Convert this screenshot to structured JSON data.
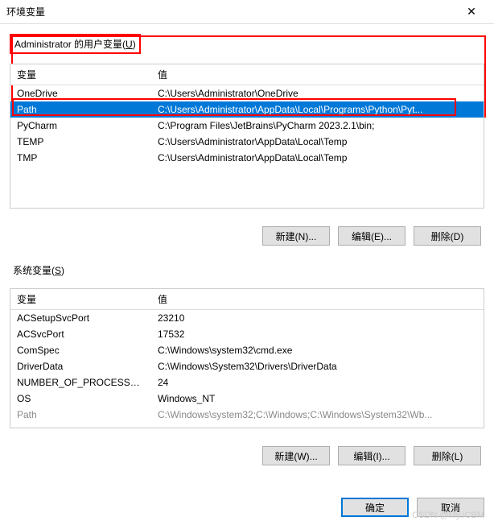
{
  "window": {
    "title": "环境变量"
  },
  "userVars": {
    "label_prefix": "Administrator 的用户变量(",
    "label_key": "U",
    "label_suffix": ")",
    "columns": {
      "name": "变量",
      "value": "值"
    },
    "rows": [
      {
        "name": "OneDrive",
        "value": "C:\\Users\\Administrator\\OneDrive"
      },
      {
        "name": "Path",
        "value": "C:\\Users\\Administrator\\AppData\\Local\\Programs\\Python\\Pyt..."
      },
      {
        "name": "PyCharm",
        "value": "C:\\Program Files\\JetBrains\\PyCharm 2023.2.1\\bin;"
      },
      {
        "name": "TEMP",
        "value": "C:\\Users\\Administrator\\AppData\\Local\\Temp"
      },
      {
        "name": "TMP",
        "value": "C:\\Users\\Administrator\\AppData\\Local\\Temp"
      }
    ],
    "buttons": {
      "new": "新建(N)...",
      "edit": "编辑(E)...",
      "delete": "删除(D)"
    }
  },
  "sysVars": {
    "label_prefix": "系统变量(",
    "label_key": "S",
    "label_suffix": ")",
    "columns": {
      "name": "变量",
      "value": "值"
    },
    "rows": [
      {
        "name": "ACSetupSvcPort",
        "value": "23210"
      },
      {
        "name": "ACSvcPort",
        "value": "17532"
      },
      {
        "name": "ComSpec",
        "value": "C:\\Windows\\system32\\cmd.exe"
      },
      {
        "name": "DriverData",
        "value": "C:\\Windows\\System32\\Drivers\\DriverData"
      },
      {
        "name": "NUMBER_OF_PROCESSORS",
        "value": "24"
      },
      {
        "name": "OS",
        "value": "Windows_NT"
      },
      {
        "name": "Path",
        "value": "C:\\Windows\\system32;C:\\Windows;C:\\Windows\\System32\\Wb..."
      }
    ],
    "buttons": {
      "new": "新建(W)...",
      "edit": "编辑(I)...",
      "delete": "删除(L)"
    }
  },
  "dialog": {
    "ok": "确定",
    "cancel": "取消"
  },
  "watermark": "CSDN @My.ICBM"
}
